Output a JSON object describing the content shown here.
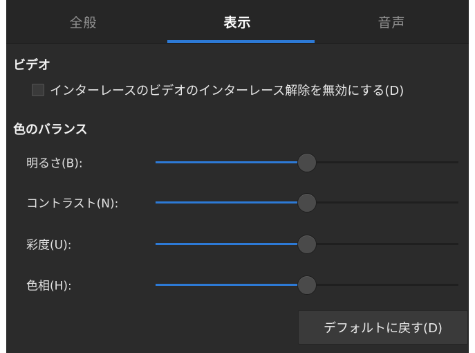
{
  "tabs": [
    {
      "label": "全般",
      "active": false
    },
    {
      "label": "表示",
      "active": true
    },
    {
      "label": "音声",
      "active": false
    }
  ],
  "video": {
    "title": "ビデオ",
    "deinterlace_checkbox": {
      "label": "インターレースのビデオのインターレース解除を無効にする(D)",
      "checked": false
    }
  },
  "color_balance": {
    "title": "色のバランス",
    "sliders": [
      {
        "label": "明るさ(B):",
        "value": 0.5
      },
      {
        "label": "コントラスト(N):",
        "value": 0.5
      },
      {
        "label": "彩度(U):",
        "value": 0.5
      },
      {
        "label": "色相(H):",
        "value": 0.5
      }
    ]
  },
  "reset_button": {
    "label": "デフォルトに戻す(D)"
  },
  "colors": {
    "accent": "#2d7ad6",
    "background": "#2b2b2b"
  }
}
